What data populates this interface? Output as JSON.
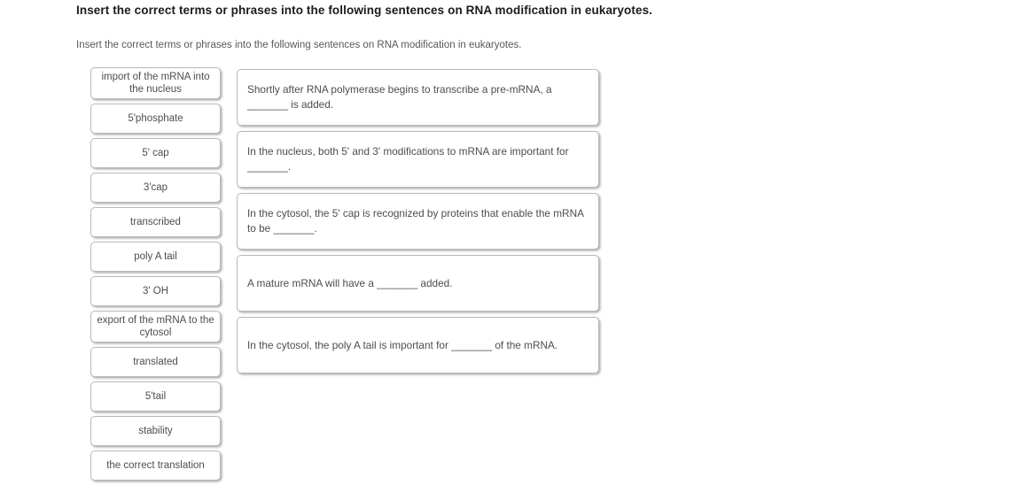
{
  "header": {
    "title": "Insert the correct terms or phrases into the following sentences on RNA modification in eukaryotes.",
    "subtitle": "Insert the correct terms or phrases into the following sentences on RNA modification in eukaryotes."
  },
  "colors": {
    "background": "#ffffff",
    "tile_border": "#b9b9b9",
    "tile_text": "#4c4d4f",
    "title_text": "#1b1b1b",
    "subtitle_text": "#58595b"
  },
  "terms": [
    {
      "label": "import of the mRNA into the nucleus"
    },
    {
      "label": "5'phosphate"
    },
    {
      "label": "5' cap"
    },
    {
      "label": "3'cap"
    },
    {
      "label": "transcribed"
    },
    {
      "label": "poly A tail"
    },
    {
      "label": "3' OH"
    },
    {
      "label": "export of the mRNA to the cytosol"
    },
    {
      "label": "translated"
    },
    {
      "label": "5'tail"
    },
    {
      "label": "stability"
    },
    {
      "label": "the correct translation"
    }
  ],
  "sentences": [
    {
      "text": "Shortly after RNA polymerase begins to transcribe a pre-mRNA, a _______ is added."
    },
    {
      "text": "In the nucleus, both 5' and 3' modifications to mRNA are important for _______."
    },
    {
      "text": "In the cytosol, the 5' cap is recognized by proteins that enable the mRNA to be _______."
    },
    {
      "text": "A mature mRNA will have a _______ added."
    },
    {
      "text": "In the cytosol, the poly A tail is important for _______ of the mRNA."
    }
  ]
}
